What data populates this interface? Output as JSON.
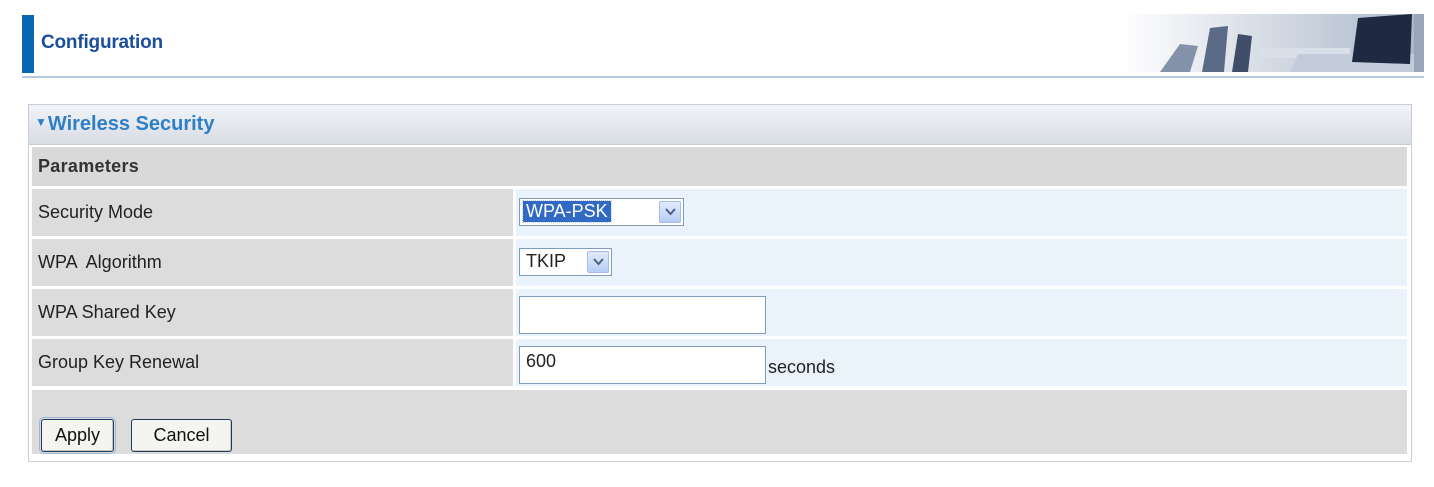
{
  "header": {
    "title": "Configuration"
  },
  "panel": {
    "title": "Wireless Security",
    "section_label": "Parameters",
    "fields": [
      {
        "label": "Security Mode",
        "type": "select",
        "value": "WPA-PSK"
      },
      {
        "label": "WPA  Algorithm",
        "type": "select",
        "value": "TKIP"
      },
      {
        "label": "WPA Shared Key",
        "type": "text",
        "value": ""
      },
      {
        "label": "Group Key Renewal",
        "type": "text",
        "value": "600",
        "unit": "seconds"
      }
    ]
  },
  "buttons": {
    "apply": "Apply",
    "cancel": "Cancel"
  },
  "colors": {
    "accent": "#0a66b2",
    "title_blue": "#2f7fc8",
    "value_bg": "#eaf2fb",
    "label_bg": "#dcdcdc"
  },
  "icons": {
    "panel_toggle": "triangle-down-icon",
    "select_arrow": "chevron-down-icon"
  }
}
